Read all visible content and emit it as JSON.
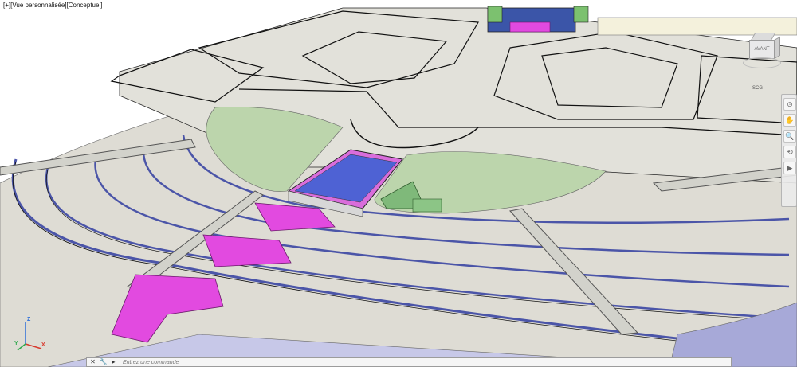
{
  "viewport": {
    "label": "[+][Vue personnalisée][Conceptuel]"
  },
  "viewcube": {
    "face_label": "AVANT",
    "wcs_label": "SCG"
  },
  "navbar": {
    "buttons": [
      "⊙",
      "✋",
      "🔍",
      "⟲",
      "▶"
    ]
  },
  "command_line": {
    "close_label": "✕",
    "options_label": "🔧",
    "recent_label": "▸",
    "placeholder": "Entrez une commande"
  },
  "ucs": {
    "x": "X",
    "y": "Y",
    "z": "Z"
  },
  "colors": {
    "ground": "#dcdcd5",
    "lawn": "#bcd5ac",
    "wall_blue": "#4b55a8",
    "magenta": "#e24ae0",
    "solar": "#4e62d4",
    "green_block": "#7fb97a",
    "edge": "#111111"
  }
}
